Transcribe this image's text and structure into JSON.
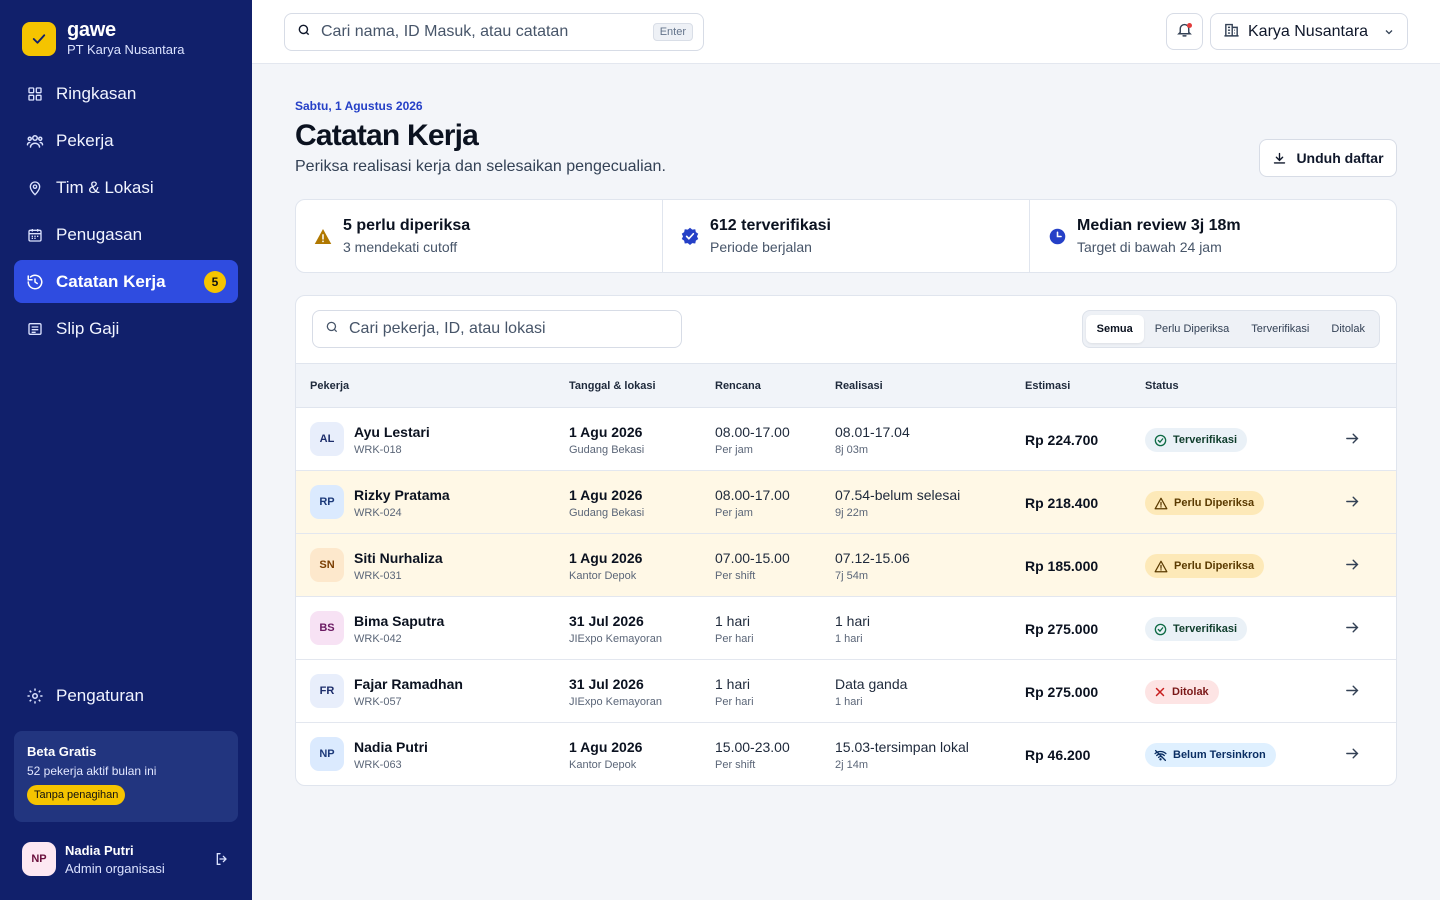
{
  "brand": {
    "name": "gawe",
    "org": "PT Karya Nusantara",
    "logo_icon": "check-icon"
  },
  "nav": {
    "items": [
      {
        "label": "Ringkasan",
        "icon": "grid-icon"
      },
      {
        "label": "Pekerja",
        "icon": "users-icon"
      },
      {
        "label": "Tim & Lokasi",
        "icon": "map-pin-icon"
      },
      {
        "label": "Penugasan",
        "icon": "calendar-icon"
      },
      {
        "label": "Catatan Kerja",
        "icon": "history-icon",
        "active": true,
        "badge": "5"
      },
      {
        "label": "Slip Gaji",
        "icon": "receipt-icon"
      }
    ],
    "settings_label": "Pengaturan"
  },
  "beta": {
    "title": "Beta Gratis",
    "subtitle": "52 pekerja aktif bulan ini",
    "pill": "Tanpa penagihan"
  },
  "user": {
    "initials": "NP",
    "name": "Nadia Putri",
    "role": "Admin organisasi"
  },
  "topbar": {
    "search_placeholder": "Cari nama, ID Masuk, atau catatan",
    "search_key": "Enter",
    "org_selector": "Karya Nusantara"
  },
  "page": {
    "date": "Sabtu, 1 Agustus 2026",
    "title": "Catatan Kerja",
    "subtitle": "Periksa realisasi kerja dan selesaikan pengecualian.",
    "download_label": "Unduh daftar"
  },
  "stats": [
    {
      "main": "5 perlu diperiksa",
      "sub": "3 mendekati cutoff",
      "icon": "warning-icon",
      "color": "#b07800"
    },
    {
      "main": "612 terverifikasi",
      "sub": "Periode berjalan",
      "icon": "verified-badge-icon",
      "color": "#2540c7"
    },
    {
      "main": "Median review 3j 18m",
      "sub": "Target di bawah 24 jam",
      "icon": "clock-icon",
      "color": "#2540c7"
    }
  ],
  "table": {
    "search_placeholder": "Cari pekerja, ID, atau lokasi",
    "filters": [
      "Semua",
      "Perlu Diperiksa",
      "Terverifikasi",
      "Ditolak"
    ],
    "active_filter": "Semua",
    "headers": {
      "worker": "Pekerja",
      "date_loc": "Tanggal & lokasi",
      "plan": "Rencana",
      "actual": "Realisasi",
      "estimate": "Estimasi",
      "status": "Status"
    },
    "rows": [
      {
        "initials": "AL",
        "name": "Ayu Lestari",
        "id": "WRK-018",
        "date": "1 Agu 2026",
        "loc": "Gudang Bekasi",
        "plan": "08.00-17.00",
        "plan_sub": "Per jam",
        "actual": "08.01-17.04",
        "actual_sub": "8j 03m",
        "estimate": "Rp 224.700",
        "status": "Terverifikasi"
      },
      {
        "initials": "RP",
        "name": "Rizky Pratama",
        "id": "WRK-024",
        "date": "1 Agu 2026",
        "loc": "Gudang Bekasi",
        "plan": "08.00-17.00",
        "plan_sub": "Per jam",
        "actual": "07.54-belum selesai",
        "actual_sub": "9j 22m",
        "estimate": "Rp 218.400",
        "status": "Perlu Diperiksa"
      },
      {
        "initials": "SN",
        "name": "Siti Nurhaliza",
        "id": "WRK-031",
        "date": "1 Agu 2026",
        "loc": "Kantor Depok",
        "plan": "07.00-15.00",
        "plan_sub": "Per shift",
        "actual": "07.12-15.06",
        "actual_sub": "7j 54m",
        "estimate": "Rp 185.000",
        "status": "Perlu Diperiksa"
      },
      {
        "initials": "BS",
        "name": "Bima Saputra",
        "id": "WRK-042",
        "date": "31 Jul 2026",
        "loc": "JIExpo Kemayoran",
        "plan": "1 hari",
        "plan_sub": "Per hari",
        "actual": "1 hari",
        "actual_sub": "1 hari",
        "estimate": "Rp 275.000",
        "status": "Terverifikasi"
      },
      {
        "initials": "FR",
        "name": "Fajar Ramadhan",
        "id": "WRK-057",
        "date": "31 Jul 2026",
        "loc": "JIExpo Kemayoran",
        "plan": "1 hari",
        "plan_sub": "Per hari",
        "actual": "Data ganda",
        "actual_sub": "1 hari",
        "estimate": "Rp 275.000",
        "status": "Ditolak"
      },
      {
        "initials": "NP",
        "name": "Nadia Putri",
        "id": "WRK-063",
        "date": "1 Agu 2026",
        "loc": "Kantor Depok",
        "plan": "15.00-23.00",
        "plan_sub": "Per shift",
        "actual": "15.03-tersimpan lokal",
        "actual_sub": "2j 14m",
        "estimate": "Rp 46.200",
        "status": "Belum Tersinkron"
      }
    ]
  },
  "colors": {
    "sidebar": "#11206b",
    "accent": "#2f4ce0",
    "brand_yellow": "#f5c400",
    "warning_row": "#fff8e6"
  }
}
